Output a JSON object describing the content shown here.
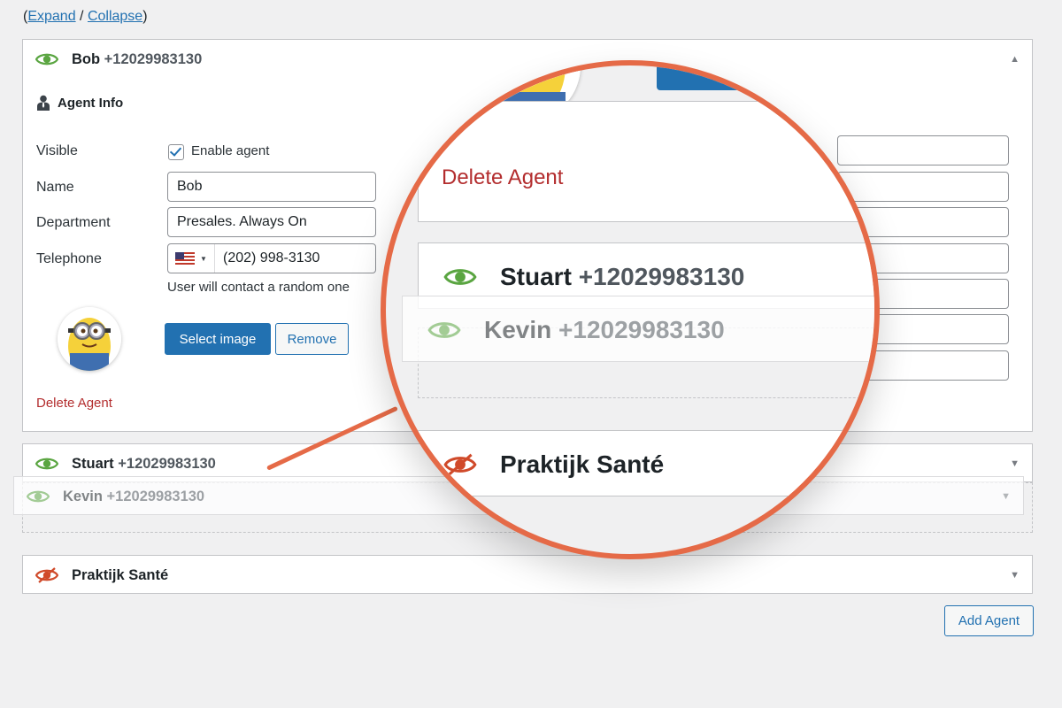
{
  "toggle": {
    "open_paren": "(",
    "expand": "Expand",
    "sep": " / ",
    "collapse": "Collapse",
    "close_paren": ")"
  },
  "agents": [
    {
      "name": "Bob",
      "phone": "+12029983130",
      "visible": true,
      "expanded": true
    },
    {
      "name": "Stuart",
      "phone": "+12029983130",
      "visible": true,
      "expanded": false
    },
    {
      "name": "Kevin",
      "phone": "+12029983130",
      "visible": true,
      "dragging": true
    },
    {
      "name": "Praktijk Santé",
      "phone": "",
      "visible": false,
      "expanded": false
    }
  ],
  "form": {
    "section_title": "Agent Info",
    "visible_label": "Visible",
    "enable_label": "Enable agent",
    "name_label": "Name",
    "name_value": "Bob",
    "department_label": "Department",
    "department_value": "Presales. Always On",
    "telephone_label": "Telephone",
    "telephone_value": "(202) 998-3130",
    "telephone_hint": "User will contact a random one",
    "select_image": "Select image",
    "remove": "Remove",
    "delete_agent": "Delete Agent"
  },
  "add_agent": "Add Agent",
  "colors": {
    "accent": "#2271b1",
    "visible_eye": "#5aa541",
    "hidden_eye": "#d04a2a",
    "danger": "#b32d2e",
    "magnifier": "#e56a47"
  },
  "icons": {
    "visible": "eye-icon",
    "hidden": "eye-slash-icon",
    "section": "user-icon",
    "expand": "triangle-up-icon",
    "collapse": "triangle-down-icon"
  }
}
